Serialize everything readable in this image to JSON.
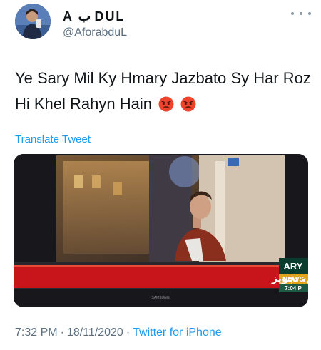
{
  "author": {
    "display_name": "A ب DUL",
    "handle": "@AforabduL"
  },
  "tweet": {
    "text": "Ye Sary Mil Ky Hmary Jazbato Sy Har Roz Hi Khel Rahyn Hain",
    "emojis": [
      "angry-face",
      "angry-face"
    ],
    "translate_label": "Translate Tweet"
  },
  "media": {
    "channel_logo": "ARY",
    "channel_sub": "NEWS",
    "clock": "7:04 P",
    "ticker_urdu": "تعلیمی اداروں کو24نومبر سے31جنوری تک بند کر دیا جائے، تجویز",
    "tv_brand": "SAMSUNG"
  },
  "footer": {
    "time": "7:32 PM",
    "date": "18/11/2020",
    "source": "Twitter for iPhone"
  },
  "colors": {
    "link": "#1d9bf0",
    "secondary_text": "#5b7083",
    "ticker_red": "#c8141b"
  }
}
